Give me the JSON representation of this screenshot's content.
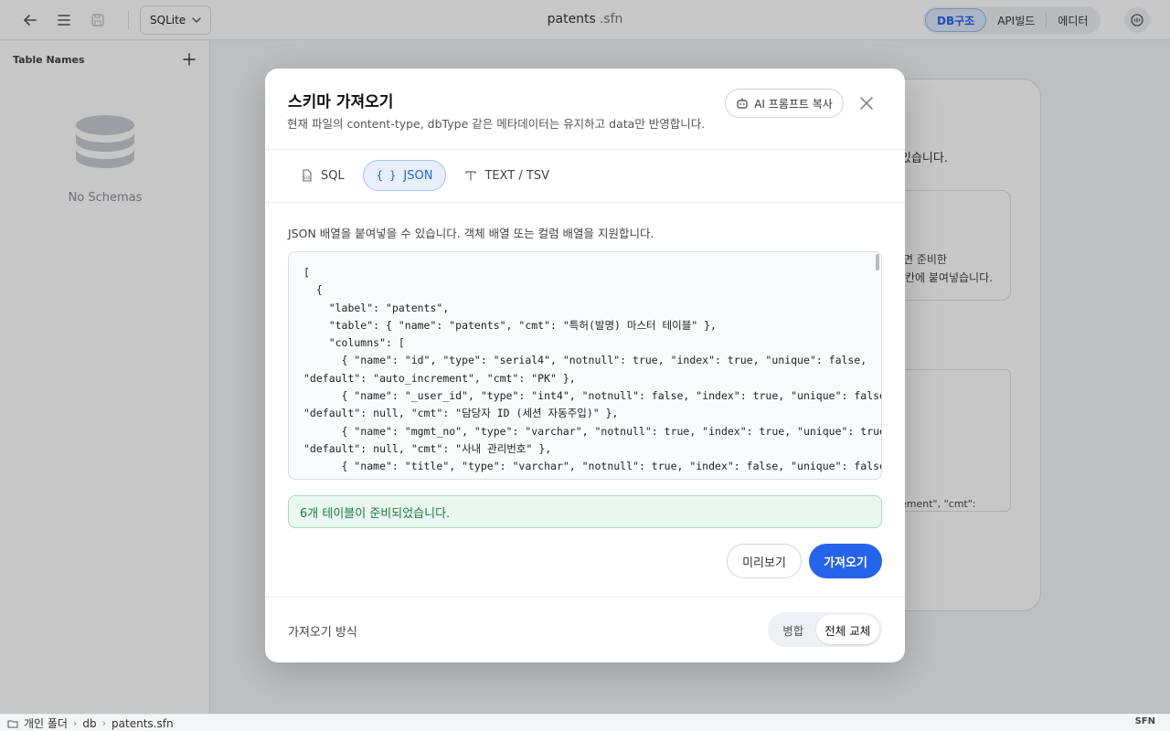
{
  "topbar": {
    "db_type": "SQLite",
    "file_name": "patents",
    "file_ext": ".sfn",
    "views": [
      "DB구조",
      "API빌드",
      "에디터"
    ]
  },
  "sidebar": {
    "title": "Table Names",
    "empty_text": "No Schemas"
  },
  "background": {
    "text1": "있습니다.",
    "text2": "면 준비한",
    "text3": "칸에 붙여넣습니다.",
    "text4": "ement\", \"cmt\":"
  },
  "modal": {
    "title": "스키마 가져오기",
    "subtitle": "현재 파일의 content-type, dbType 같은 메타데이터는 유지하고 data만 반영합니다.",
    "ai_button": "AI 프롬프트 복사",
    "tabs": [
      {
        "label": "SQL",
        "icon": "sql-file-icon"
      },
      {
        "label": "JSON",
        "icon": "braces-icon"
      },
      {
        "label": "TEXT / TSV",
        "icon": "text-icon"
      }
    ],
    "active_tab": "JSON",
    "hint": "JSON 배열을 붙여넣을 수 있습니다. 객체 배열 또는 컬럼 배열을 지원합니다.",
    "code": "[\n  {\n    \"label\": \"patents\",\n    \"table\": { \"name\": \"patents\", \"cmt\": \"특허(발명) 마스터 테이블\" },\n    \"columns\": [\n      { \"name\": \"id\", \"type\": \"serial4\", \"notnull\": true, \"index\": true, \"unique\": false,\n\"default\": \"auto_increment\", \"cmt\": \"PK\" },\n      { \"name\": \"_user_id\", \"type\": \"int4\", \"notnull\": false, \"index\": true, \"unique\": false,\n\"default\": null, \"cmt\": \"담당자 ID (세션 자동주입)\" },\n      { \"name\": \"mgmt_no\", \"type\": \"varchar\", \"notnull\": true, \"index\": true, \"unique\": true,\n\"default\": null, \"cmt\": \"사내 관리번호\" },\n      { \"name\": \"title\", \"type\": \"varchar\", \"notnull\": true, \"index\": false, \"unique\": false,",
    "status": "6개 테이블이 준비되었습니다.",
    "preview_button": "미리보기",
    "import_button": "가져오기",
    "mode_label": "가져오기 방식",
    "modes": [
      "병합",
      "전체 교체"
    ],
    "active_mode": "전체 교체"
  },
  "statusbar": {
    "breadcrumbs": [
      "개인 폴더",
      "db",
      "patents.sfn"
    ],
    "right": "SFN"
  },
  "colors": {
    "accent": "#2563eb",
    "success_bg": "#e9f7ef",
    "success_text": "#1e7a45"
  }
}
